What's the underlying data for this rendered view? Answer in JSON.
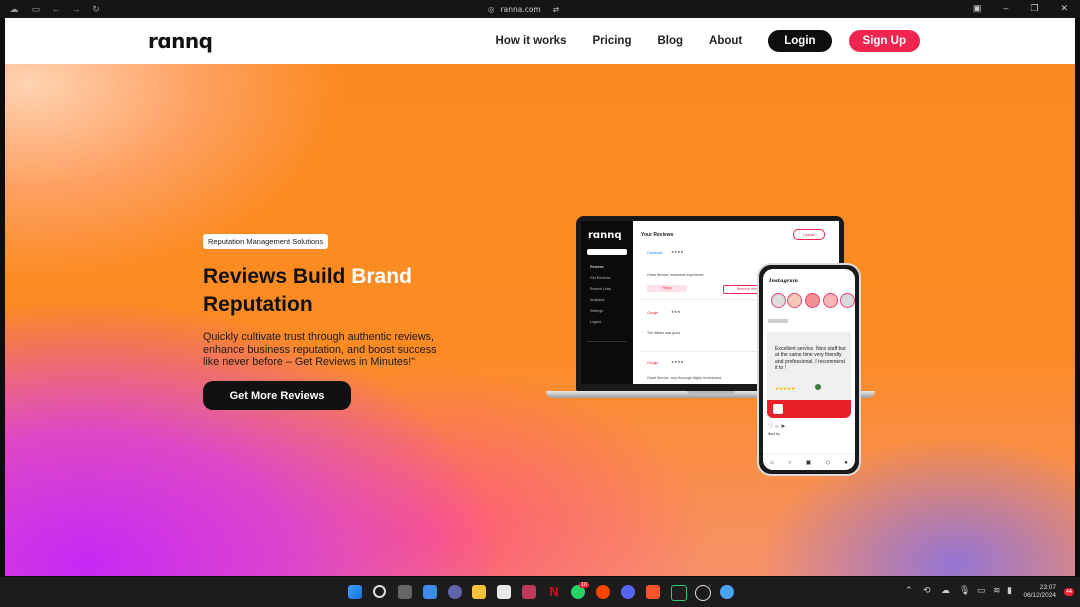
{
  "browser": {
    "url": "ranna.com",
    "icons": [
      "ghost-icon",
      "sidebar-icon",
      "back-icon",
      "forward-icon",
      "reload-icon"
    ],
    "window_controls": [
      "extension-icon",
      "minimize-icon",
      "maximize-icon",
      "close-icon"
    ]
  },
  "nav": {
    "logo": "rɑnnq",
    "links": [
      "How it works",
      "Pricing",
      "Blog",
      "About"
    ],
    "login": "Login",
    "signup": "Sign Up"
  },
  "hero": {
    "badge": "Reputation Management Solutions",
    "headline_part1": "Reviews Build ",
    "headline_highlight": "Brand",
    "headline_part2": "Reputation",
    "subtext": "Quickly cultivate trust through authentic reviews, enhance business reputation, and boost success like never before – Get Reviews in Minutes!\"",
    "cta": "Get More Reviews"
  },
  "laptop_mock": {
    "logo": "rɑnnq",
    "title": "Your Reviews",
    "update": "Update",
    "menu": [
      "Reviews",
      "Get Reviews",
      "Review Links",
      "Analytics",
      "Settings",
      "Logout"
    ],
    "reviews": [
      {
        "source": "Facebook",
        "text": "Great Service, awesome experience",
        "action": "Reply",
        "action2": "Remove from w"
      },
      {
        "source": "Google",
        "text": "The dishes was good"
      },
      {
        "source": "Google",
        "text": "Great Service, very thorough highly recommend"
      }
    ]
  },
  "phone_mock": {
    "app": "Instagram",
    "quote": "Excellent service. Nice staff but at the same time very friendly and professional, I recommend it to !",
    "footer_text": "liked by"
  },
  "taskbar": {
    "apps": [
      "windows-icon",
      "search-icon",
      "task-view-icon",
      "widgets-icon",
      "teams-icon",
      "file-explorer-icon",
      "store-icon",
      "app-icon",
      "netflix-icon",
      "whatsapp-icon",
      "reddit-icon",
      "discord-icon",
      "brave-icon",
      "terminal-icon",
      "chatgpt-icon",
      "browser-icon"
    ],
    "whatsapp_badge": "10",
    "time": "23:07",
    "date": "06/12/2024",
    "notification_count": "44"
  }
}
